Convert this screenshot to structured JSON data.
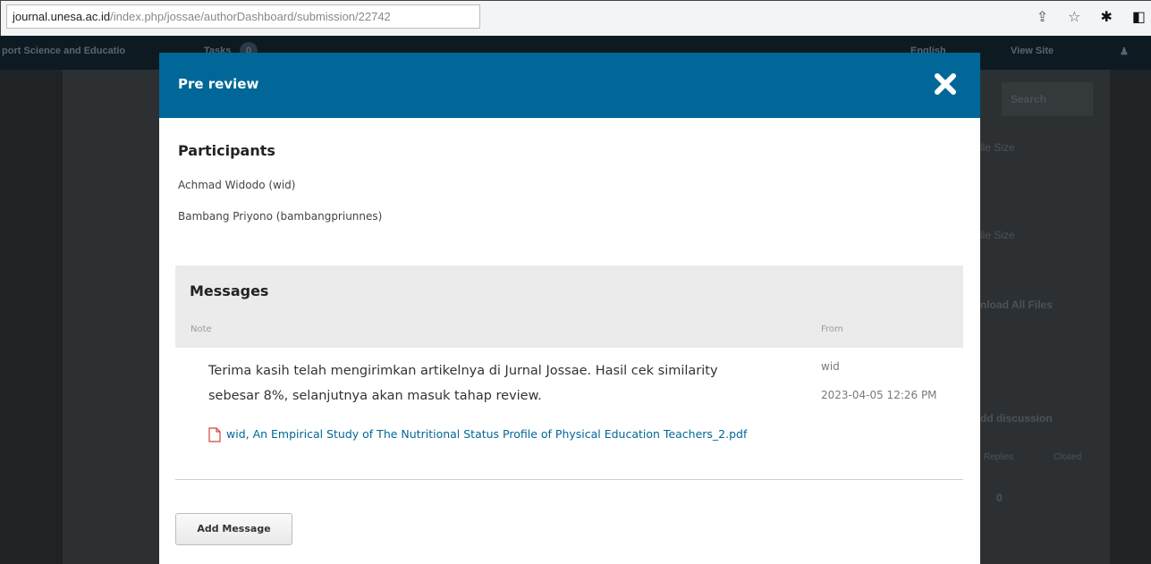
{
  "browser": {
    "url_host": "journal.unesa.ac.id",
    "url_path": "/index.php/jossae/authorDashboard/submission/22742"
  },
  "background": {
    "journal_name": "port Science and Educatio",
    "tasks": "Tasks",
    "task_count": "0",
    "english": "English",
    "view_site": "View Site",
    "user": "",
    "search": "Search",
    "file1": "ile Size",
    "file2": "ile Size",
    "download_all": "nload All Files",
    "add_discussion": "dd discussion",
    "replies": "Replies",
    "closed": "Closed",
    "count": "0"
  },
  "modal": {
    "title": "Pre review",
    "participants_heading": "Participants",
    "participants": [
      "Achmad Widodo (wid)",
      "Bambang Priyono (bambangpriunnes)"
    ],
    "messages_heading": "Messages",
    "col_note": "Note",
    "col_from": "From",
    "message": {
      "text": "Terima kasih telah mengirimkan artikelnya di Jurnal Jossae. Hasil cek similarity sebesar 8%, selanjutnya akan masuk tahap review.",
      "file": "wid, An Empirical Study of The Nutritional Status Profile of Physical Education Teachers_2.pdf",
      "from": "wid",
      "date": "2023-04-05 12:26 PM"
    },
    "add_message_label": "Add Message"
  }
}
